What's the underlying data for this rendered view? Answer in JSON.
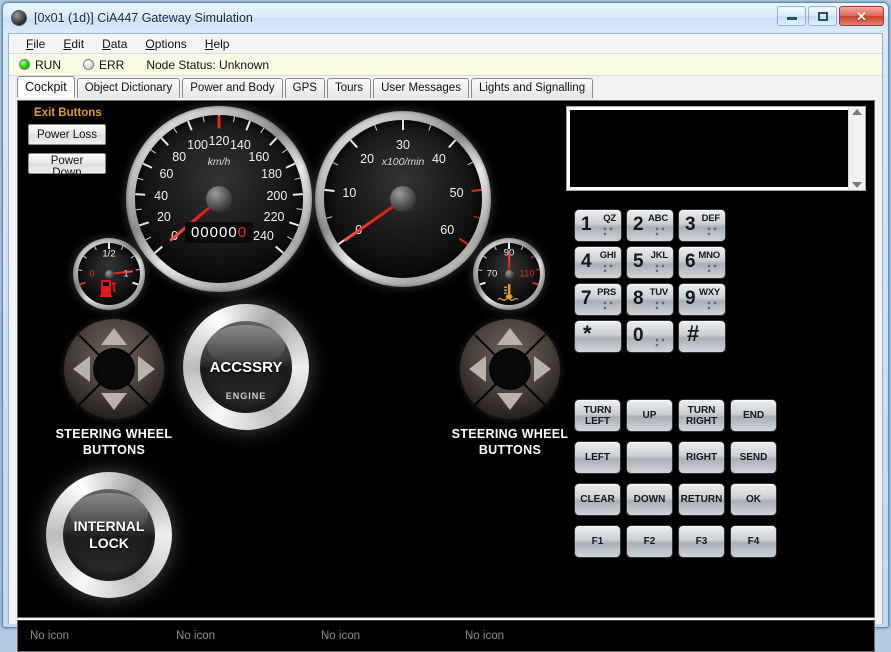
{
  "window": {
    "title": "[0x01 (1d)] CiA447 Gateway Simulation",
    "icon": "app-globe-icon",
    "controls": {
      "minimize": "–",
      "maximize": "□",
      "close": "✕"
    }
  },
  "menubar": {
    "items": [
      {
        "label": "File",
        "accel": "F"
      },
      {
        "label": "Edit",
        "accel": "E"
      },
      {
        "label": "Data",
        "accel": "D"
      },
      {
        "label": "Options",
        "accel": "O"
      },
      {
        "label": "Help",
        "accel": "H"
      }
    ]
  },
  "status": {
    "run_label": "RUN",
    "err_label": "ERR",
    "run_color": "#24e000",
    "err_color": "#dcdcdc",
    "node_status": "Node Status: Unknown",
    "background": "#fbfbe4"
  },
  "tabs": {
    "active_index": 0,
    "items": [
      {
        "label": "Cockpit"
      },
      {
        "label": "Object Dictionary"
      },
      {
        "label": "Power and Body"
      },
      {
        "label": "GPS"
      },
      {
        "label": "Tours"
      },
      {
        "label": "User Messages"
      },
      {
        "label": "Lights and Signalling"
      }
    ]
  },
  "exit_panel": {
    "title": "Exit Buttons",
    "title_color": "#e09a26",
    "buttons": [
      {
        "label": "Power Loss"
      },
      {
        "label": "Power Down"
      }
    ]
  },
  "speedometer": {
    "unit": "km/h",
    "ticks": [
      0,
      20,
      40,
      60,
      80,
      100,
      120,
      140,
      160,
      180,
      200,
      220,
      240
    ],
    "min": 0,
    "max": 240,
    "value": 0,
    "redline_mark": 120,
    "odometer_white": "00000",
    "odometer_red": "0"
  },
  "tachometer": {
    "unit": "x100/min",
    "ticks": [
      0,
      10,
      20,
      30,
      40,
      50,
      60
    ],
    "min": 0,
    "max": 60,
    "value": 0,
    "redzone_start": 48
  },
  "fuel_gauge": {
    "ticks": [
      "0",
      "1/2",
      "1"
    ],
    "value": 0.88,
    "icon": "fuel-pump-icon",
    "icon_color": "#e31919",
    "zero_color": "#ea2d1a"
  },
  "temp_gauge": {
    "ticks": [
      "70",
      "90",
      "110"
    ],
    "value": 0.5,
    "icon": "coolant-temp-icon",
    "icon_color": "#e09a26",
    "hot_color": "#ea2d1a"
  },
  "engine_button": {
    "label": "ACCSSRY",
    "sub_label": "ENGINE"
  },
  "lock_button": {
    "label_line1": "INTERNAL",
    "label_line2": "LOCK"
  },
  "steering_left": {
    "label_line1": "STEERING WHEEL",
    "label_line2": "BUTTONS",
    "arrows": [
      "up-arrow-icon",
      "right-arrow-icon",
      "down-arrow-icon",
      "left-arrow-icon"
    ]
  },
  "steering_right": {
    "label_line1": "STEERING WHEEL",
    "label_line2": "BUTTONS",
    "arrows": [
      "up-arrow-icon",
      "right-arrow-icon",
      "down-arrow-icon",
      "left-arrow-icon"
    ]
  },
  "display": {
    "text": "",
    "background": "#000000",
    "scroll_up": "scroll-up-icon",
    "scroll_down": "scroll-down-icon"
  },
  "keypad": {
    "keys": [
      {
        "digit": "1",
        "letters": "QZ",
        "dots": true
      },
      {
        "digit": "2",
        "letters": "ABC",
        "dots": true
      },
      {
        "digit": "3",
        "letters": "DEF",
        "dots": true
      },
      {
        "digit": "4",
        "letters": "GHI",
        "dots": true
      },
      {
        "digit": "5",
        "letters": "JKL",
        "dots": true
      },
      {
        "digit": "6",
        "letters": "MNO",
        "dots": true
      },
      {
        "digit": "7",
        "letters": "PRS",
        "dots": true
      },
      {
        "digit": "8",
        "letters": "TUV",
        "dots": true
      },
      {
        "digit": "9",
        "letters": "WXY",
        "dots": true
      },
      {
        "digit": "*",
        "letters": "",
        "dots": false
      },
      {
        "digit": "0",
        "letters": "",
        "dots": true
      },
      {
        "digit": "#",
        "letters": "",
        "dots": false
      }
    ]
  },
  "function_keys": {
    "keys": [
      {
        "line1": "TURN",
        "line2": "LEFT"
      },
      {
        "line1": "UP",
        "line2": ""
      },
      {
        "line1": "TURN",
        "line2": "RIGHT"
      },
      {
        "line1": "END",
        "line2": ""
      },
      {
        "line1": "LEFT",
        "line2": ""
      },
      {
        "line1": "",
        "line2": ""
      },
      {
        "line1": "RIGHT",
        "line2": ""
      },
      {
        "line1": "SEND",
        "line2": ""
      },
      {
        "line1": "CLEAR",
        "line2": ""
      },
      {
        "line1": "DOWN",
        "line2": ""
      },
      {
        "line1": "RETURN",
        "line2": ""
      },
      {
        "line1": "OK",
        "line2": ""
      },
      {
        "line1": "F1",
        "line2": ""
      },
      {
        "line1": "F2",
        "line2": ""
      },
      {
        "line1": "F3",
        "line2": ""
      },
      {
        "line1": "F4",
        "line2": ""
      }
    ]
  },
  "icon_bar": {
    "slots": [
      {
        "label": "No icon"
      },
      {
        "label": "No icon"
      },
      {
        "label": "No icon"
      },
      {
        "label": "No icon"
      }
    ]
  }
}
